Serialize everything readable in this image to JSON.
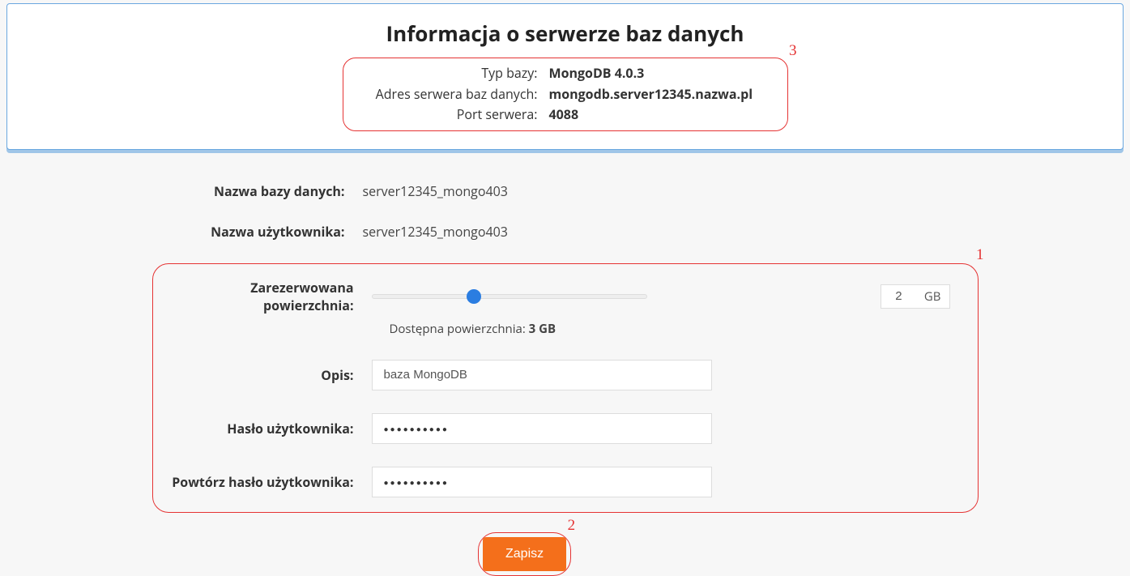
{
  "info": {
    "title": "Informacja o serwerze baz danych",
    "rows": {
      "type_label": "Typ bazy:",
      "type_value": "MongoDB 4.0.3",
      "addr_label": "Adres serwera baz danych:",
      "addr_value": "mongodb.server12345.nazwa.pl",
      "port_label": "Port serwera:",
      "port_value": "4088"
    }
  },
  "form": {
    "dbname_label": "Nazwa bazy danych:",
    "dbname_value": "server12345_mongo403",
    "user_label": "Nazwa użytkownika:",
    "user_value": "server12345_mongo403",
    "reserved_label": "Zarezerwowana powierzchnia:",
    "reserved_value": "2",
    "reserved_unit": "GB",
    "avail_label": "Dostępna powierzchnia: ",
    "avail_value": "3 GB",
    "desc_label": "Opis:",
    "desc_value": "baza MongoDB",
    "pass_label": "Hasło użytkownika:",
    "pass_dots": "●●●●●●●●●●",
    "pass2_label": "Powtórz hasło użytkownika:",
    "pass2_dots": "●●●●●●●●●●"
  },
  "markers": {
    "m1": "1",
    "m2": "2",
    "m3": "3"
  },
  "actions": {
    "save": "Zapisz"
  }
}
